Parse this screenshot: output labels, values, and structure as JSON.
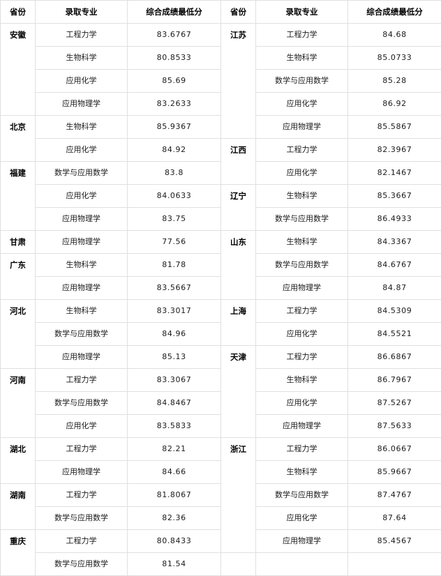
{
  "headers": {
    "province": "省份",
    "major": "录取专业",
    "score": "综合成绩最低分"
  },
  "left_table": {
    "groups": [
      {
        "province": "安徽",
        "rows": [
          {
            "major": "工程力学",
            "score": "83.6767"
          },
          {
            "major": "生物科学",
            "score": "80.8533"
          },
          {
            "major": "应用化学",
            "score": "85.69"
          },
          {
            "major": "应用物理学",
            "score": "83.2633"
          }
        ]
      },
      {
        "province": "北京",
        "rows": [
          {
            "major": "生物科学",
            "score": "85.9367"
          },
          {
            "major": "应用化学",
            "score": "84.92"
          }
        ]
      },
      {
        "province": "福建",
        "rows": [
          {
            "major": "数学与应用数学",
            "score": "83.8"
          },
          {
            "major": "应用化学",
            "score": "84.0633"
          },
          {
            "major": "应用物理学",
            "score": "83.75"
          }
        ]
      },
      {
        "province": "甘肃",
        "rows": [
          {
            "major": "应用物理学",
            "score": "77.56"
          }
        ]
      },
      {
        "province": "广东",
        "rows": [
          {
            "major": "生物科学",
            "score": "81.78"
          },
          {
            "major": "应用物理学",
            "score": "83.5667"
          }
        ]
      },
      {
        "province": "河北",
        "rows": [
          {
            "major": "生物科学",
            "score": "83.3017"
          },
          {
            "major": "数学与应用数学",
            "score": "84.96"
          },
          {
            "major": "应用物理学",
            "score": "85.13"
          }
        ]
      },
      {
        "province": "河南",
        "rows": [
          {
            "major": "工程力学",
            "score": "83.3067"
          },
          {
            "major": "数学与应用数学",
            "score": "84.8467"
          },
          {
            "major": "应用化学",
            "score": "83.5833"
          }
        ]
      },
      {
        "province": "湖北",
        "rows": [
          {
            "major": "工程力学",
            "score": "82.21"
          },
          {
            "major": "应用物理学",
            "score": "84.66"
          }
        ]
      },
      {
        "province": "湖南",
        "rows": [
          {
            "major": "工程力学",
            "score": "81.8067"
          },
          {
            "major": "数学与应用数学",
            "score": "82.36"
          }
        ]
      },
      {
        "province": "重庆",
        "rows": [
          {
            "major": "工程力学",
            "score": "80.8433"
          },
          {
            "major": "数学与应用数学",
            "score": "81.54"
          }
        ]
      }
    ]
  },
  "right_table": {
    "groups": [
      {
        "province": "江苏",
        "rows": [
          {
            "major": "工程力学",
            "score": "84.68"
          },
          {
            "major": "生物科学",
            "score": "85.0733"
          },
          {
            "major": "数学与应用数学",
            "score": "85.28"
          },
          {
            "major": "应用化学",
            "score": "86.92"
          },
          {
            "major": "应用物理学",
            "score": "85.5867"
          }
        ]
      },
      {
        "province": "江西",
        "rows": [
          {
            "major": "工程力学",
            "score": "82.3967"
          },
          {
            "major": "应用化学",
            "score": "82.1467"
          }
        ]
      },
      {
        "province": "辽宁",
        "rows": [
          {
            "major": "生物科学",
            "score": "85.3667"
          },
          {
            "major": "数学与应用数学",
            "score": "86.4933"
          }
        ]
      },
      {
        "province": "山东",
        "rows": [
          {
            "major": "生物科学",
            "score": "84.3367"
          },
          {
            "major": "数学与应用数学",
            "score": "84.6767"
          },
          {
            "major": "应用物理学",
            "score": "84.87"
          }
        ]
      },
      {
        "province": "上海",
        "rows": [
          {
            "major": "工程力学",
            "score": "84.5309"
          },
          {
            "major": "应用化学",
            "score": "84.5521"
          }
        ]
      },
      {
        "province": "天津",
        "rows": [
          {
            "major": "工程力学",
            "score": "86.6867"
          },
          {
            "major": "生物科学",
            "score": "86.7967"
          },
          {
            "major": "应用化学",
            "score": "87.5267"
          },
          {
            "major": "应用物理学",
            "score": "87.5633"
          }
        ]
      },
      {
        "province": "浙江",
        "rows": [
          {
            "major": "工程力学",
            "score": "86.0667"
          },
          {
            "major": "生物科学",
            "score": "85.9667"
          },
          {
            "major": "数学与应用数学",
            "score": "87.4767"
          },
          {
            "major": "应用化学",
            "score": "87.64"
          },
          {
            "major": "应用物理学",
            "score": "85.4567"
          }
        ]
      }
    ],
    "trailing_blank_row": true
  }
}
